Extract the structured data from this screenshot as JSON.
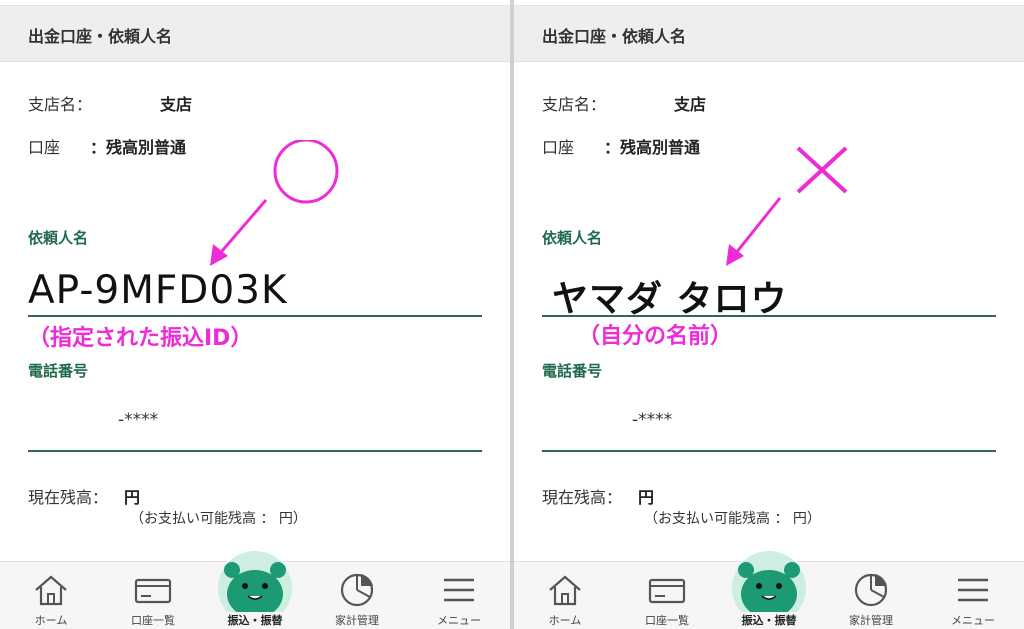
{
  "left": {
    "header_title": "出金口座・依頼人名",
    "branch_label": "支店名：",
    "branch_suffix": "支店",
    "account_label": "口座",
    "account_value": "：残高別普通",
    "requester_label": "依頼人名",
    "requester_value": "AP-9MFD03K",
    "note": "（指定された振込ID）",
    "phone_label": "電話番号",
    "phone_value": "-****",
    "balance_label": "現在残高：",
    "balance_value": "円",
    "payable_note": "（お支払い可能残高 ： 円）",
    "mark": "○",
    "mark_color": "#ee2bd7"
  },
  "right": {
    "header_title": "出金口座・依頼人名",
    "branch_label": "支店名：",
    "branch_suffix": "支店",
    "account_label": "口座",
    "account_value": "：残高別普通",
    "requester_label": "依頼人名",
    "requester_value": "ヤマダ タロウ",
    "note": "（自分の名前）",
    "phone_label": "電話番号",
    "phone_value": "-****",
    "balance_label": "現在残高：",
    "balance_value": "円",
    "payable_note": "（お支払い可能残高 ： 円）",
    "mark": "×",
    "mark_color": "#ee2bd7"
  },
  "tabs": [
    {
      "label": "ホーム",
      "icon": "home-icon"
    },
    {
      "label": "口座一覧",
      "icon": "card-icon"
    },
    {
      "label": "振込・振替",
      "icon": "mascot-icon",
      "active": true
    },
    {
      "label": "家計管理",
      "icon": "pie-chart-icon"
    },
    {
      "label": "メニュー",
      "icon": "menu-icon"
    }
  ],
  "colors": {
    "accent_green": "#1f6a4a",
    "annotation_magenta": "#ee2bd7",
    "mascot_green": "#1b9a73"
  }
}
